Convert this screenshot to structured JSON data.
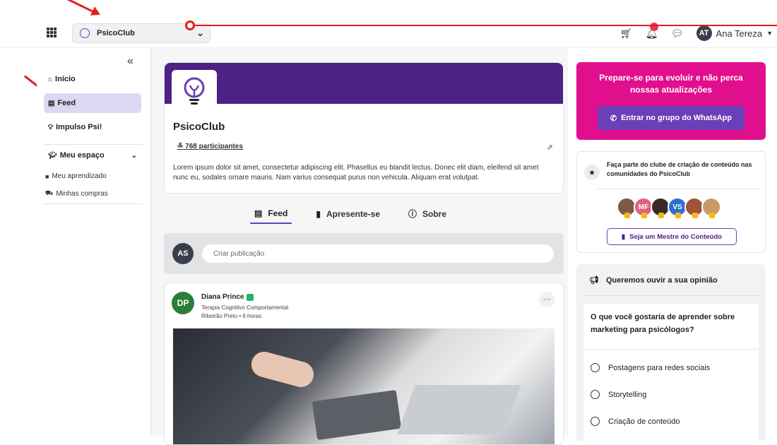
{
  "topbar": {
    "community_name": "PsicoClub",
    "user_initials": "AT",
    "user_name": "Ana Tereza"
  },
  "sidebar": {
    "items": [
      {
        "label": "Início",
        "icon": "home-icon"
      },
      {
        "label": "Feed",
        "icon": "feed-icon",
        "active": true
      },
      {
        "label": "Impulso Psi!",
        "icon": "lightbulb-icon"
      },
      {
        "label": "Meu espaço",
        "icon": "graduation-cap-icon"
      }
    ],
    "subitems": [
      {
        "label": "Meu aprendizado",
        "icon": "book-icon"
      },
      {
        "label": "Minhas compras",
        "icon": "cart-icon"
      }
    ]
  },
  "community": {
    "title": "PsicoClub",
    "participants": "768 participantes",
    "description": "Lorem ipsum dolor sit amet, consectetur adipiscing elit. Phasellus eu blandit lectus. Donec elit diam, eleifend sit amet nunc eu, sodales ornare mauris. Nam varius consequat purus non vehicula. Aliquam erat volutpat."
  },
  "tabs": [
    {
      "label": "Feed",
      "icon": "feed-icon",
      "active": true
    },
    {
      "label": "Apresente-se",
      "icon": "id-card-icon"
    },
    {
      "label": "Sobre",
      "icon": "info-icon"
    }
  ],
  "composer": {
    "avatar": "AS",
    "placeholder": "Criar publicação"
  },
  "post": {
    "avatar": "DP",
    "author": "Diana Prince",
    "specialty": "Terapia Cognitivo Comportamental",
    "meta": "Ribeirão Preto • 6 horas",
    "more": "···"
  },
  "promo": {
    "title": "Prepare-se para evoluir e não perca nossas atualizações",
    "button": "Entrar no grupo do WhatsApp",
    "color": "#e10f8e"
  },
  "club": {
    "text": "Faça parte  do clube de criação de conteúdo nas comunidades do  PsicoClub",
    "avatars": [
      "",
      "MF",
      "",
      "VS",
      "",
      ""
    ],
    "button": "Seja um Mestre do Conteúdo"
  },
  "poll": {
    "heading": "Queremos ouvir a sua opinião",
    "question": "O que você gostaria de aprender sobre marketing para psicólogos?",
    "options": [
      "Postagens para redes sociais",
      "Storytelling",
      "Criação de conteúdo"
    ]
  },
  "colors": {
    "accent": "#6a3fb8",
    "banner": "#4d2185",
    "annotation": "#e01e1e"
  }
}
